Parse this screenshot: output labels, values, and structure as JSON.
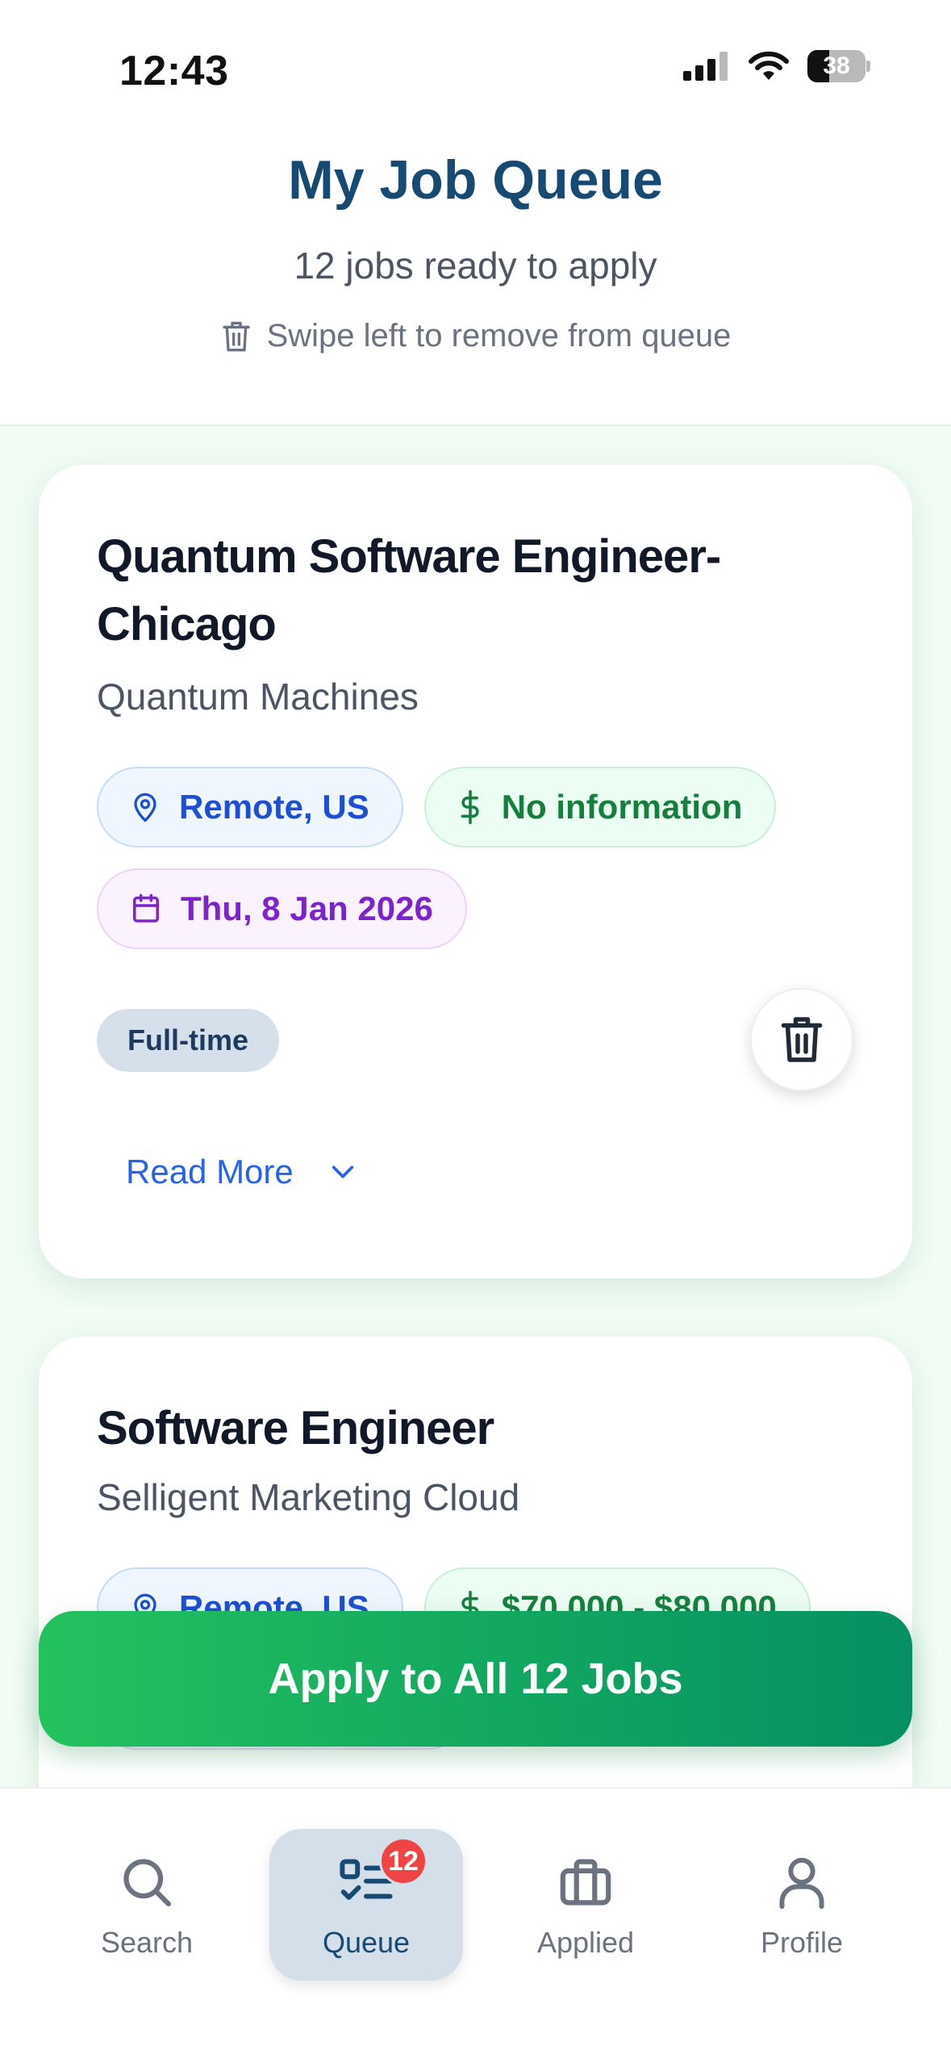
{
  "status_bar": {
    "time": "12:43",
    "battery_level": 38,
    "battery_text": "38"
  },
  "header": {
    "title": "My Job Queue",
    "subtitle": "12 jobs ready to apply",
    "hint": "Swipe left to remove from queue"
  },
  "jobs": [
    {
      "title": "Quantum Software Engineer-Chicago",
      "company": "Quantum Machines",
      "location": "Remote, US",
      "salary": "No information",
      "date": "Thu, 8 Jan 2026",
      "type": "Full-time",
      "read_more": "Read More"
    },
    {
      "title": "Software Engineer",
      "company": "Selligent Marketing Cloud",
      "location": "Remote, US",
      "salary": "$70,000 - $80,000"
    }
  ],
  "apply_all_label": "Apply to All 12 Jobs",
  "tabs": [
    {
      "label": "Search",
      "icon": "search-icon"
    },
    {
      "label": "Queue",
      "icon": "queue-icon",
      "badge": "12",
      "active": true
    },
    {
      "label": "Applied",
      "icon": "briefcase-icon"
    },
    {
      "label": "Profile",
      "icon": "person-icon"
    }
  ],
  "colors": {
    "title": "#164a72",
    "location_chip": "#1d4ed8",
    "salary_chip": "#15803d",
    "date_chip": "#7e22ce",
    "badge": "#ef4444",
    "apply_gradient_start": "#23c25e",
    "apply_gradient_end": "#078f63"
  }
}
